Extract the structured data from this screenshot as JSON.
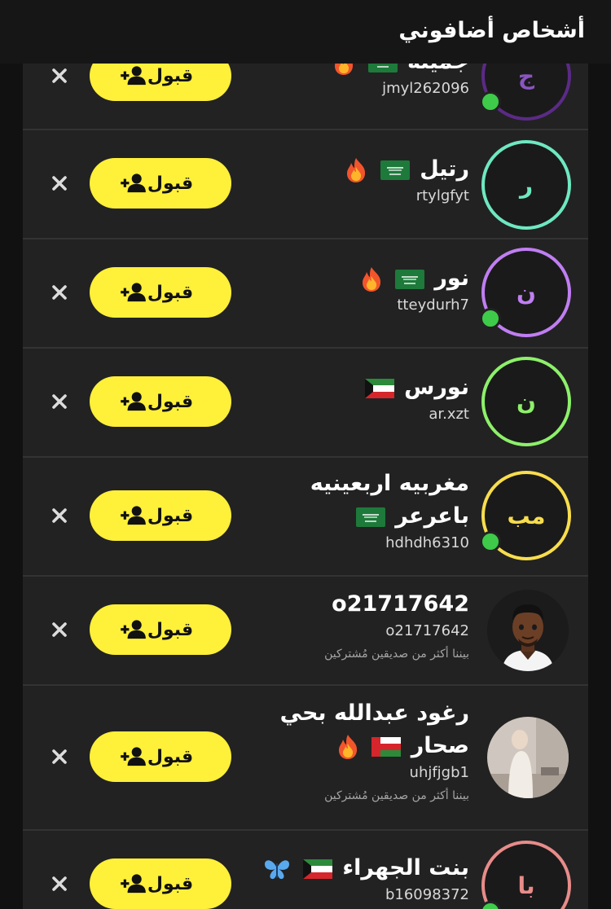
{
  "header": {
    "title": "أشخاص أضافوني"
  },
  "buttons": {
    "accept_label": "قبول"
  },
  "mutual_text": "بيننا أكثر من صديقين مُشتركين",
  "colors": {
    "accent_yellow": "#fff03a",
    "online_green": "#3ecb4a",
    "ring_purple_dark": "#5b2a86",
    "ring_teal": "#6ee8c1",
    "ring_lilac": "#c07ef2",
    "ring_lime": "#8df06a",
    "ring_yellow": "#f8dd4d",
    "ring_pink": "#e88c8a"
  },
  "rows": [
    {
      "initials": "ج",
      "name": "جميلة",
      "username": "jmyl262096",
      "online": true
    },
    {
      "initials": "ر",
      "name": "رتيل",
      "username": "rtylgfyt",
      "online": false
    },
    {
      "initials": "ن",
      "name": "نور",
      "username": "tteydurh7",
      "online": true
    },
    {
      "initials": "ن",
      "name": "نورس",
      "username": "ar.xzt",
      "online": false
    },
    {
      "initials": "مب",
      "name_line1": "مغربيه اربعينيه",
      "name_line2": "باعرعر",
      "username": "hdhdh6310",
      "online": true
    },
    {
      "name": "o21717642",
      "username": "o21717642",
      "mutual": true
    },
    {
      "name_line1": "رغود عبدالله بحي",
      "name_line2": "صحار",
      "username": "uhjfjgb1",
      "mutual": true
    },
    {
      "initials": "با",
      "name": "بنت الجهراء",
      "username": "b16098372",
      "online": true
    }
  ],
  "icons": [
    "add-friend-icon",
    "close-icon",
    "fire-emoji-icon",
    "saudi-flag-icon",
    "kuwait-flag-icon",
    "oman-flag-icon",
    "butterfly-emoji-icon",
    "bitmoji-avatar",
    "profile-photo"
  ]
}
